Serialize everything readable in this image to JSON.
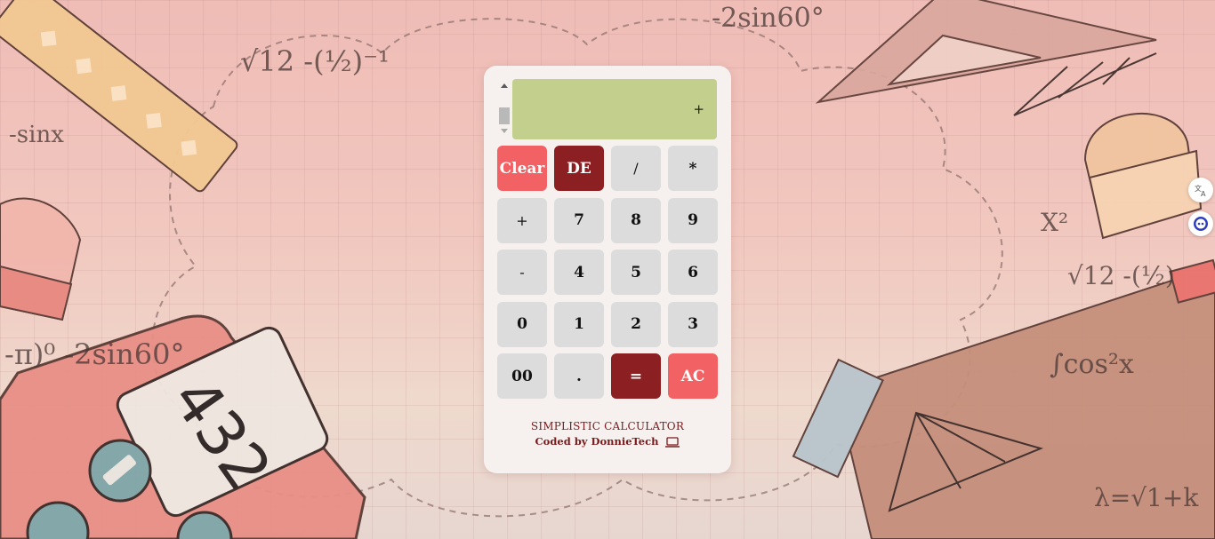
{
  "display": {
    "value": "+"
  },
  "keys": [
    {
      "label": "Clear",
      "name": "clear-button",
      "style": "red"
    },
    {
      "label": "DE",
      "name": "delete-button",
      "style": "dark"
    },
    {
      "label": "/",
      "name": "divide-button",
      "style": "op"
    },
    {
      "label": "*",
      "name": "multiply-button",
      "style": ""
    },
    {
      "label": "+",
      "name": "add-button",
      "style": "op"
    },
    {
      "label": "7",
      "name": "digit-7-button",
      "style": ""
    },
    {
      "label": "8",
      "name": "digit-8-button",
      "style": ""
    },
    {
      "label": "9",
      "name": "digit-9-button",
      "style": ""
    },
    {
      "label": "-",
      "name": "subtract-button",
      "style": "op"
    },
    {
      "label": "4",
      "name": "digit-4-button",
      "style": ""
    },
    {
      "label": "5",
      "name": "digit-5-button",
      "style": ""
    },
    {
      "label": "6",
      "name": "digit-6-button",
      "style": ""
    },
    {
      "label": "0",
      "name": "digit-0-button",
      "style": ""
    },
    {
      "label": "1",
      "name": "digit-1-button",
      "style": ""
    },
    {
      "label": "2",
      "name": "digit-2-button",
      "style": ""
    },
    {
      "label": "3",
      "name": "digit-3-button",
      "style": ""
    },
    {
      "label": "00",
      "name": "double-zero-button",
      "style": ""
    },
    {
      "label": ".",
      "name": "decimal-button",
      "style": ""
    },
    {
      "label": "=",
      "name": "equals-button",
      "style": "dark"
    },
    {
      "label": "AC",
      "name": "all-clear-button",
      "style": "red"
    }
  ],
  "footer": {
    "title": "SIMPLISTIC CALCULATOR",
    "credit": "Coded by DonnieTech",
    "icon": "laptop-icon"
  },
  "side_buttons": [
    {
      "icon": "translate-icon"
    },
    {
      "icon": "assistant-icon"
    }
  ],
  "colors": {
    "display": "#c3cf8c",
    "accent_red": "#f26163",
    "accent_dark": "#8c1f22",
    "key": "#dcdcdc",
    "footer_text": "#7a1a1c"
  }
}
